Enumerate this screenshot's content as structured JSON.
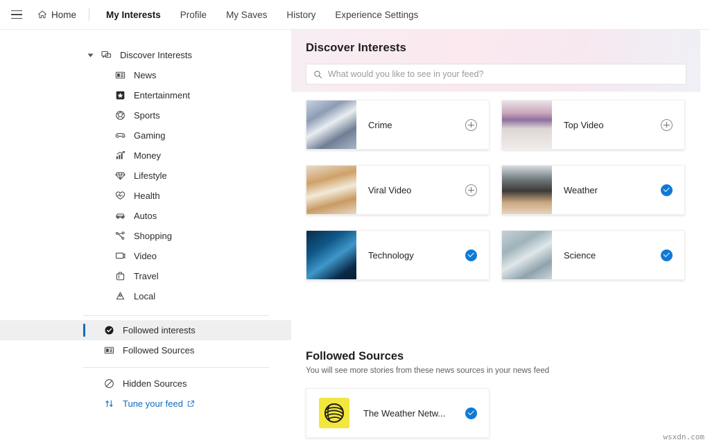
{
  "topnav": {
    "menu_icon": "hamburger-icon",
    "home": {
      "label": "Home",
      "icon": "home-icon"
    },
    "items": [
      {
        "label": "My Interests",
        "active": true
      },
      {
        "label": "Profile",
        "active": false
      },
      {
        "label": "My Saves",
        "active": false
      },
      {
        "label": "History",
        "active": false
      },
      {
        "label": "Experience Settings",
        "active": false
      }
    ]
  },
  "sidebar": {
    "root": {
      "label": "Discover Interests",
      "icon": "discover-interests-icon",
      "expanded": true
    },
    "categories": [
      {
        "label": "News",
        "icon": "news-icon"
      },
      {
        "label": "Entertainment",
        "icon": "star-icon"
      },
      {
        "label": "Sports",
        "icon": "sports-ball-icon"
      },
      {
        "label": "Gaming",
        "icon": "gamepad-icon"
      },
      {
        "label": "Money",
        "icon": "chart-money-icon"
      },
      {
        "label": "Lifestyle",
        "icon": "diamond-icon"
      },
      {
        "label": "Health",
        "icon": "heart-icon"
      },
      {
        "label": "Autos",
        "icon": "car-icon"
      },
      {
        "label": "Shopping",
        "icon": "shopping-tag-icon"
      },
      {
        "label": "Video",
        "icon": "video-icon"
      },
      {
        "label": "Travel",
        "icon": "suitcase-icon"
      },
      {
        "label": "Local",
        "icon": "location-pin-icon"
      }
    ],
    "followed": [
      {
        "label": "Followed interests",
        "icon": "check-circle-filled-icon",
        "selected": true
      },
      {
        "label": "Followed Sources",
        "icon": "news-icon",
        "selected": false
      }
    ],
    "extras": [
      {
        "label": "Hidden Sources",
        "icon": "block-icon"
      }
    ],
    "tune": {
      "label": "Tune your feed",
      "icon": "sort-arrows-icon",
      "external_icon": "external-link-icon"
    }
  },
  "discover": {
    "title": "Discover Interests",
    "search_placeholder": "What would you like to see in your feed?",
    "search_value": "",
    "search_icon": "search-icon"
  },
  "interest_cards": [
    {
      "label": "",
      "thumb": "th-santa",
      "state": "hidden_label",
      "toggle": "none"
    },
    {
      "label": "",
      "thumb": "th-sunset",
      "state": "hidden_label",
      "toggle": "none"
    },
    {
      "label": "Crime",
      "thumb": "th-crime",
      "toggle": "add"
    },
    {
      "label": "Top Video",
      "thumb": "th-tv",
      "toggle": "add"
    },
    {
      "label": "Viral Video",
      "thumb": "th-dog",
      "toggle": "add"
    },
    {
      "label": "Weather",
      "thumb": "th-tornado",
      "toggle": "following"
    },
    {
      "label": "Technology",
      "thumb": "th-tech",
      "toggle": "following"
    },
    {
      "label": "Science",
      "thumb": "th-science",
      "toggle": "following"
    }
  ],
  "followed_sources": {
    "title": "Followed Sources",
    "subtitle": "You will see more stories from these news sources in your news feed",
    "sources": [
      {
        "name": "The Weather Netw...",
        "logo": "weather-network-logo",
        "toggle": "following"
      }
    ]
  },
  "watermark": "wsxdn.com",
  "colors": {
    "accent_blue": "#0f6cbd",
    "toggle_blue": "#0f7ad6",
    "selected_bg": "#efefef",
    "link_blue": "#0f6cbd"
  }
}
